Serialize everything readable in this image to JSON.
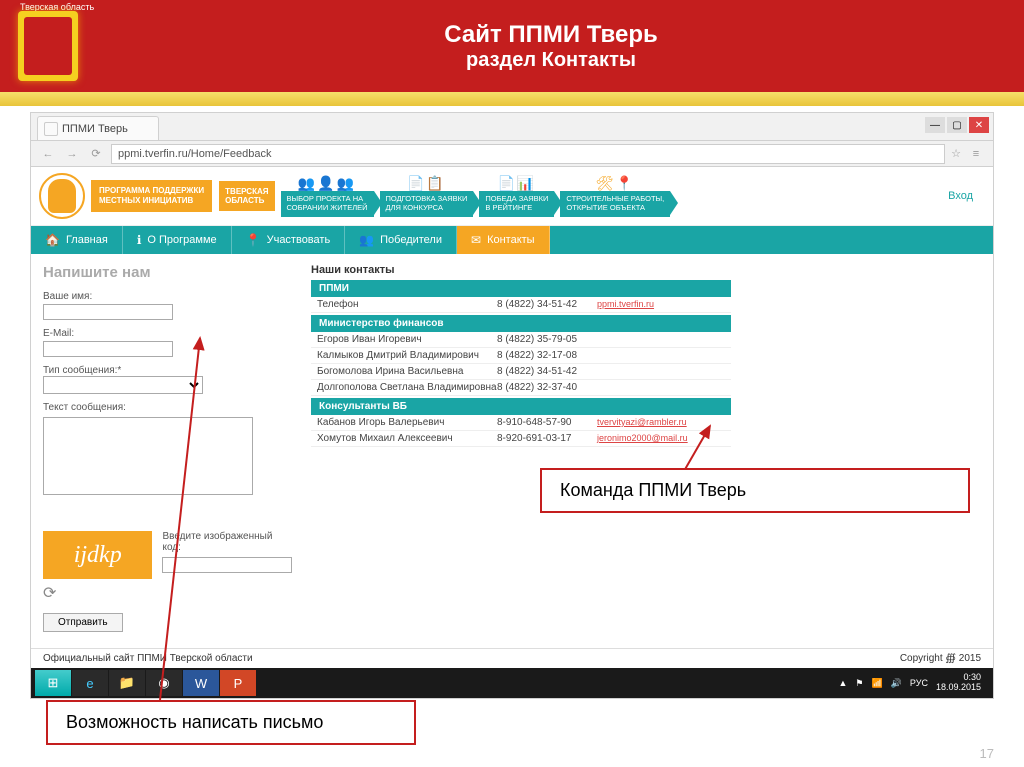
{
  "banner": {
    "region": "Тверская область",
    "title": "Сайт ППМИ Тверь",
    "subtitle": "раздел Контакты"
  },
  "browser": {
    "tab": "ППМИ Тверь",
    "url": "ppmi.tverfin.ru/Home/Feedback"
  },
  "logo": {
    "line1": "ПРОГРАММА ПОДДЕРЖКИ",
    "line2": "МЕСТНЫХ ИНИЦИАТИВ",
    "line3": "ТВЕРСКАЯ",
    "line4": "ОБЛАСТЬ"
  },
  "steps": {
    "s1a": "ВЫБОР ПРОЕКТА НА",
    "s1b": "СОБРАНИИ ЖИТЕЛЕЙ",
    "s2a": "ПОДГОТОВКА ЗАЯВКИ",
    "s2b": "ДЛЯ КОНКУРСА",
    "s3a": "ПОБЕДА ЗАЯВКИ",
    "s3b": "В РЕЙТИНГЕ",
    "s4a": "СТРОИТЕЛЬНЫЕ РАБОТЫ,",
    "s4b": "ОТКРЫТИЕ ОБЪЕКТА"
  },
  "login": "Вход",
  "nav": {
    "home": "Главная",
    "about": "О Программе",
    "part": "Участвовать",
    "win": "Победители",
    "cont": "Контакты"
  },
  "form": {
    "heading": "Напишите нам",
    "name": "Ваше имя:",
    "email": "E-Mail:",
    "type": "Тип сообщения:*",
    "text": "Текст сообщения:",
    "captcha_label": "Введите изображенный код:",
    "captcha": "ijdkp",
    "submit": "Отправить"
  },
  "contacts": {
    "heading": "Наши контакты",
    "sec1": "ППМИ",
    "row1n": "Телефон",
    "row1p": "8 (4822) 34-51-42",
    "row1e": "ppmi.tverfin.ru",
    "sec2": "Министерство финансов",
    "row2n": "Егоров Иван Игоревич",
    "row2p": "8 (4822) 35-79-05",
    "row3n": "Калмыков Дмитрий Владимирович",
    "row3p": "8 (4822) 32-17-08",
    "row4n": "Богомолова Ирина Васильевна",
    "row4p": "8 (4822) 34-51-42",
    "row5n": "Долгополова Светлана Владимировна",
    "row5p": "8 (4822) 32-37-40",
    "sec3": "Консультанты ВБ",
    "row6n": "Кабанов Игорь Валерьевич",
    "row6p": "8-910-648-57-90",
    "row6e": "tvervityazi@rambler.ru",
    "row7n": "Хомутов Михаил Алексеевич",
    "row7p": "8-920-691-03-17",
    "row7e": "jeronimo2000@mail.ru"
  },
  "footer": {
    "left": "Официальный сайт ППМИ Тверской области",
    "right": "Copyright ∰ 2015"
  },
  "callouts": {
    "c1": "Команда ППМИ Тверь",
    "c2": "Возможность написать письмо"
  },
  "slide_num": "17",
  "taskbar": {
    "lang": "РУС",
    "time": "0:30",
    "date": "18.09.2015"
  }
}
